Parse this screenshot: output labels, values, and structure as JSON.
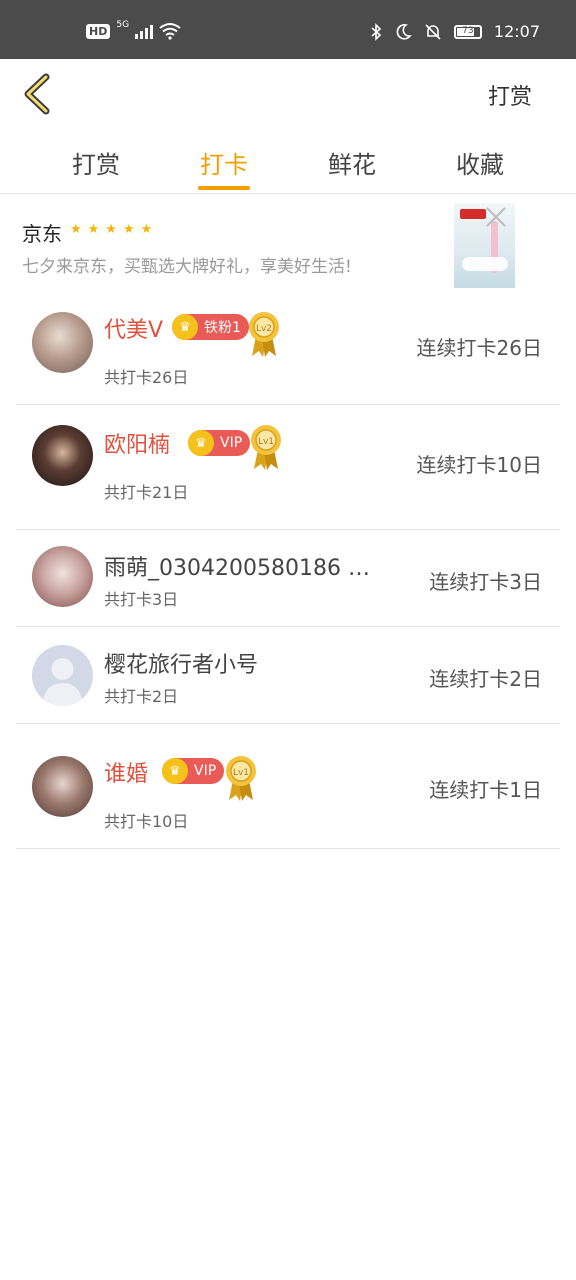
{
  "status_bar": {
    "network": "5G",
    "hd": "HD",
    "battery": "73",
    "time": "12:07"
  },
  "header": {
    "reward_link": "打赏"
  },
  "tabs": [
    {
      "label": "打赏",
      "active": false
    },
    {
      "label": "打卡",
      "active": true
    },
    {
      "label": "鲜花",
      "active": false
    },
    {
      "label": "收藏",
      "active": false
    }
  ],
  "ad": {
    "brand": "京东",
    "rating_stars": 5,
    "description": "七夕来京东，买甄选大牌好礼，享美好生活!"
  },
  "checkins": [
    {
      "nickname": "代美V",
      "badge": "铁粉1",
      "medal": "Lv2",
      "total": "共打卡26日",
      "streak": "连续打卡26日"
    },
    {
      "nickname": "欧阳楠",
      "badge": "VIP",
      "medal": "Lv1",
      "total": "共打卡21日",
      "streak": "连续打卡10日"
    },
    {
      "nickname": "雨萌_0304200580186 …",
      "badge": "",
      "medal": "",
      "total": "共打卡3日",
      "streak": "连续打卡3日"
    },
    {
      "nickname": "樱花旅行者小号",
      "badge": "",
      "medal": "",
      "total": "共打卡2日",
      "streak": "连续打卡2日"
    },
    {
      "nickname": "谁婚",
      "badge": "VIP",
      "medal": "Lv1",
      "total": "共打卡10日",
      "streak": "连续打卡1日"
    }
  ],
  "colors": {
    "accent": "#f0a000",
    "nickname_red": "#e0523e",
    "badge_red": "#e85b57",
    "crown_yellow": "#f5c21b",
    "status_bar": "#4b4b4b"
  }
}
